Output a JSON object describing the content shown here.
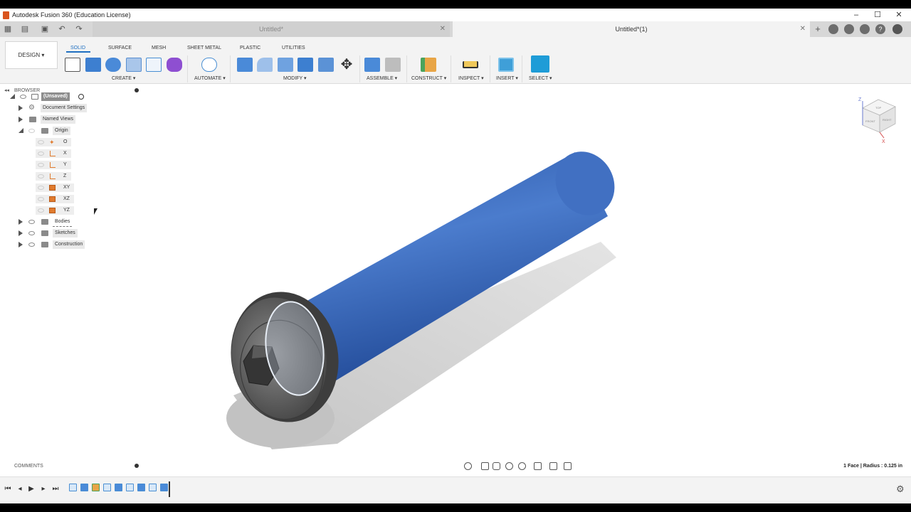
{
  "window": {
    "title": "Autodesk Fusion 360 (Education License)",
    "controls": [
      "–",
      "☐",
      "✕"
    ]
  },
  "tabs": [
    {
      "label": "Untitled*",
      "active": false
    },
    {
      "label": "Untitled*(1)",
      "active": true
    }
  ],
  "ribbon": {
    "workspace": "DESIGN ▾",
    "tabs": [
      "SOLID",
      "SURFACE",
      "MESH",
      "SHEET METAL",
      "PLASTIC",
      "UTILITIES"
    ],
    "groups": [
      "CREATE ▾",
      "AUTOMATE ▾",
      "MODIFY ▾",
      "ASSEMBLE ▾",
      "CONSTRUCT ▾",
      "INSPECT ▾",
      "INSERT ▾",
      "SELECT ▾"
    ]
  },
  "browser": {
    "title": "BROWSER",
    "root": "(Unsaved)",
    "items": [
      {
        "label": "Document Settings"
      },
      {
        "label": "Named Views"
      },
      {
        "label": "Origin"
      },
      {
        "label": "O"
      },
      {
        "label": "X"
      },
      {
        "label": "Y"
      },
      {
        "label": "Z"
      },
      {
        "label": "XY"
      },
      {
        "label": "XZ"
      },
      {
        "label": "YZ"
      },
      {
        "label": "Bodies"
      },
      {
        "label": "Sketches"
      },
      {
        "label": "Construction"
      }
    ]
  },
  "viewcube": {
    "top": "TOP",
    "front": "FRONT",
    "right": "RIGHT",
    "axis_z": "Z",
    "axis_x": "X"
  },
  "comments": {
    "title": "COMMENTS"
  },
  "status": {
    "text": "1 Face | Radius : 0.125 in"
  },
  "colors": {
    "body_blue": "#2f5fb3",
    "head_gray": "#6e6e6e",
    "accent": "#1f6fc1"
  }
}
